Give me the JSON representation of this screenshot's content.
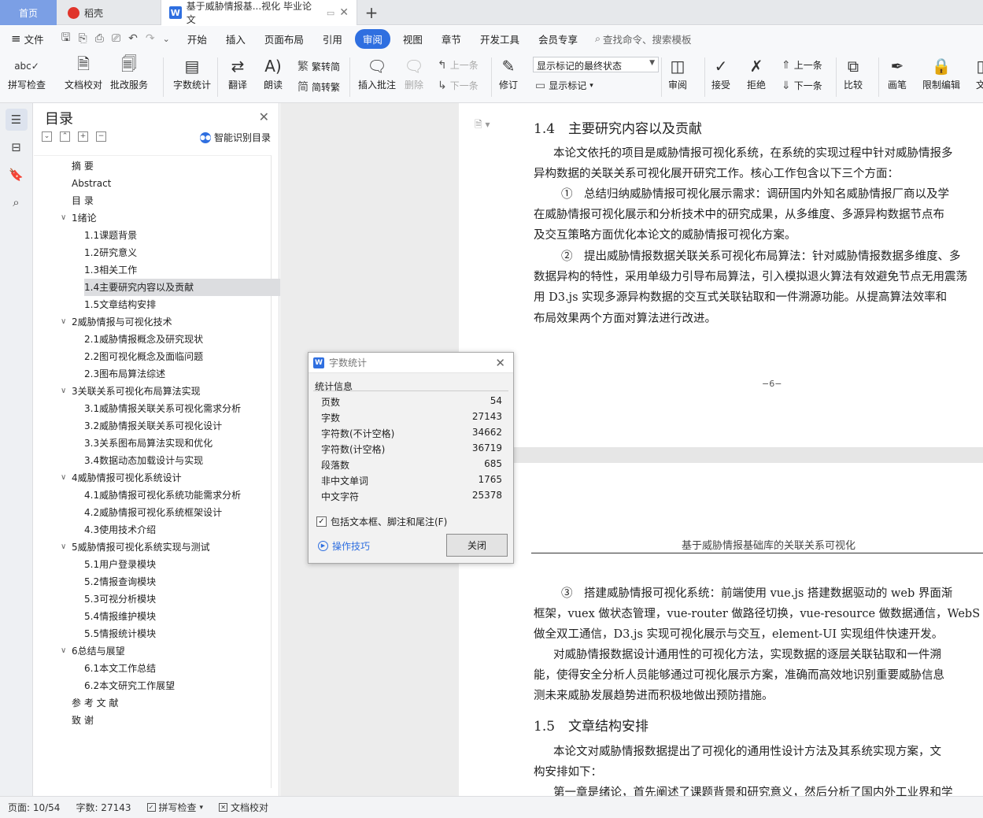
{
  "tabs": {
    "home": "首页",
    "daoke": "稻壳",
    "doc": "基于威胁情报基...视化 毕业论文"
  },
  "menu": {
    "file": "文件",
    "items": [
      "开始",
      "插入",
      "页面布局",
      "引用",
      "审阅",
      "视图",
      "章节",
      "开发工具",
      "会员专享"
    ],
    "active": "审阅",
    "search": "查找命令、搜索模板"
  },
  "ribbon": {
    "spell": "拼写检查",
    "doc_check": "文档校对",
    "batch": "批改服务",
    "word_count": "字数统计",
    "translate": "翻译",
    "read": "朗读",
    "trad": "繁转简",
    "simp": "简转繁",
    "insert_comment": "插入批注",
    "delete": "删除",
    "prev_c": "上一条",
    "next_c": "下一条",
    "revise": "修订",
    "markup_state": "显示标记的最终状态",
    "show_markup": "显示标记",
    "review": "审阅",
    "accept": "接受",
    "reject": "拒绝",
    "prev": "上一条",
    "next": "下一条",
    "compare": "比较",
    "pen": "画笔",
    "restrict": "限制编辑",
    "doc_more": "文"
  },
  "toc": {
    "title": "目录",
    "ai_label": "智能识别目录",
    "items": [
      {
        "label": "摘 要",
        "level": 0
      },
      {
        "label": "Abstract",
        "level": 0
      },
      {
        "label": "目 录",
        "level": 0
      },
      {
        "label": "1绪论",
        "level": 1
      },
      {
        "label": "1.1课题背景",
        "level": 2
      },
      {
        "label": "1.2研究意义",
        "level": 2
      },
      {
        "label": "1.3相关工作",
        "level": 2
      },
      {
        "label": "1.4主要研究内容以及贡献",
        "level": 2,
        "selected": true
      },
      {
        "label": "1.5文章结构安排",
        "level": 2
      },
      {
        "label": "2威胁情报与可视化技术",
        "level": 1
      },
      {
        "label": "2.1威胁情报概念及研究现状",
        "level": 2
      },
      {
        "label": "2.2图可视化概念及面临问题",
        "level": 2
      },
      {
        "label": "2.3图布局算法综述",
        "level": 2
      },
      {
        "label": "3关联关系可视化布局算法实现",
        "level": 1
      },
      {
        "label": "3.1威胁情报关联关系可视化需求分析",
        "level": 2
      },
      {
        "label": "3.2威胁情报关联关系可视化设计",
        "level": 2
      },
      {
        "label": "3.3关系图布局算法实现和优化",
        "level": 2
      },
      {
        "label": "3.4数据动态加载设计与实现",
        "level": 2
      },
      {
        "label": "4威胁情报可视化系统设计",
        "level": 1
      },
      {
        "label": "4.1威胁情报可视化系统功能需求分析",
        "level": 2
      },
      {
        "label": "4.2威胁情报可视化系统框架设计",
        "level": 2
      },
      {
        "label": "4.3使用技术介绍",
        "level": 2
      },
      {
        "label": "5威胁情报可视化系统实现与测试",
        "level": 1
      },
      {
        "label": "5.1用户登录模块",
        "level": 2
      },
      {
        "label": "5.2情报查询模块",
        "level": 2
      },
      {
        "label": "5.3可视分析模块",
        "level": 2
      },
      {
        "label": "5.4情报维护模块",
        "level": 2
      },
      {
        "label": "5.5情报统计模块",
        "level": 2
      },
      {
        "label": "6总结与展望",
        "level": 1
      },
      {
        "label": "6.1本文工作总结",
        "level": 2
      },
      {
        "label": "6.2本文研究工作展望",
        "level": 2
      },
      {
        "label": "参 考 文 献",
        "level": 0
      },
      {
        "label": "致 谢",
        "level": 0
      }
    ]
  },
  "document": {
    "heading_14": "1.4　主要研究内容以及贡献",
    "p1": "本论文依托的项目是威胁情报可视化系统，在系统的实现过程中针对威胁情报多",
    "p1b": "异构数据的关联关系可视化展开研究工作。核心工作包含以下三个方面：",
    "p2": "①　总结归纳威胁情报可视化展示需求：调研国内外知名威胁情报厂商以及学",
    "p2b": "在威胁情报可视化展示和分析技术中的研究成果，从多维度、多源异构数据节点布",
    "p2c": "及交互策略方面优化本论文的威胁情报可视化方案。",
    "p3": "②　提出威胁情报数据关联关系可视化布局算法：针对威胁情报数据多维度、多",
    "p3b": "数据异构的特性，采用单级力引导布局算法，引入模拟退火算法有效避免节点无用震荡",
    "p3c": "用 D3.js 实现多源异构数据的交互式关联钻取和一件溯源功能。从提高算法效率和",
    "p3d": "布局效果两个方面对算法进行改进。",
    "page_num": "−6−",
    "header": "基于威胁情报基础库的关联关系可视化",
    "p4": "③　搭建威胁情报可视化系统：前端使用 vue.js 搭建数据驱动的 web 界面渐",
    "p4b": "框架，vuex 做状态管理，vue-router 做路径切换，vue-resource 做数据通信，WebS",
    "p4c": "做全双工通信，D3.js 实现可视化展示与交互，element-UI 实现组件快速开发。",
    "p5": "对威胁情报数据设计通用性的可视化方法，实现数据的逐层关联钻取和一件溯",
    "p5b": "能，使得安全分析人员能够通过可视化展示方案，准确而高效地识别重要威胁信息",
    "p5c": "测未来威胁发展趋势进而积极地做出预防措施。",
    "heading_15": "1.5　文章结构安排",
    "p6": "本论文对威胁情报数据提出了可视化的通用性设计方法及其系统实现方案，文",
    "p6b": "构安排如下：",
    "p7": "第一章是绪论，首先阐述了课题背景和研究意义，然后分析了国内外工业界和学"
  },
  "dialog": {
    "title": "字数统计",
    "section": "统计信息",
    "stats": [
      {
        "label": "页数",
        "value": "54"
      },
      {
        "label": "字数",
        "value": "27143"
      },
      {
        "label": "字符数(不计空格)",
        "value": "34662"
      },
      {
        "label": "字符数(计空格)",
        "value": "36719"
      },
      {
        "label": "段落数",
        "value": "685"
      },
      {
        "label": "非中文单词",
        "value": "1765"
      },
      {
        "label": "中文字符",
        "value": "25378"
      }
    ],
    "include_label": "包括文本框、脚注和尾注(F)",
    "tips": "操作技巧",
    "close": "关闭"
  },
  "status": {
    "page": "页面: 10/54",
    "words": "字数: 27143",
    "spell": "拼写检查",
    "doc_check": "文档校对"
  },
  "colors": {
    "accent": "#2f6fe0",
    "home_tab": "#7b9fe5"
  }
}
